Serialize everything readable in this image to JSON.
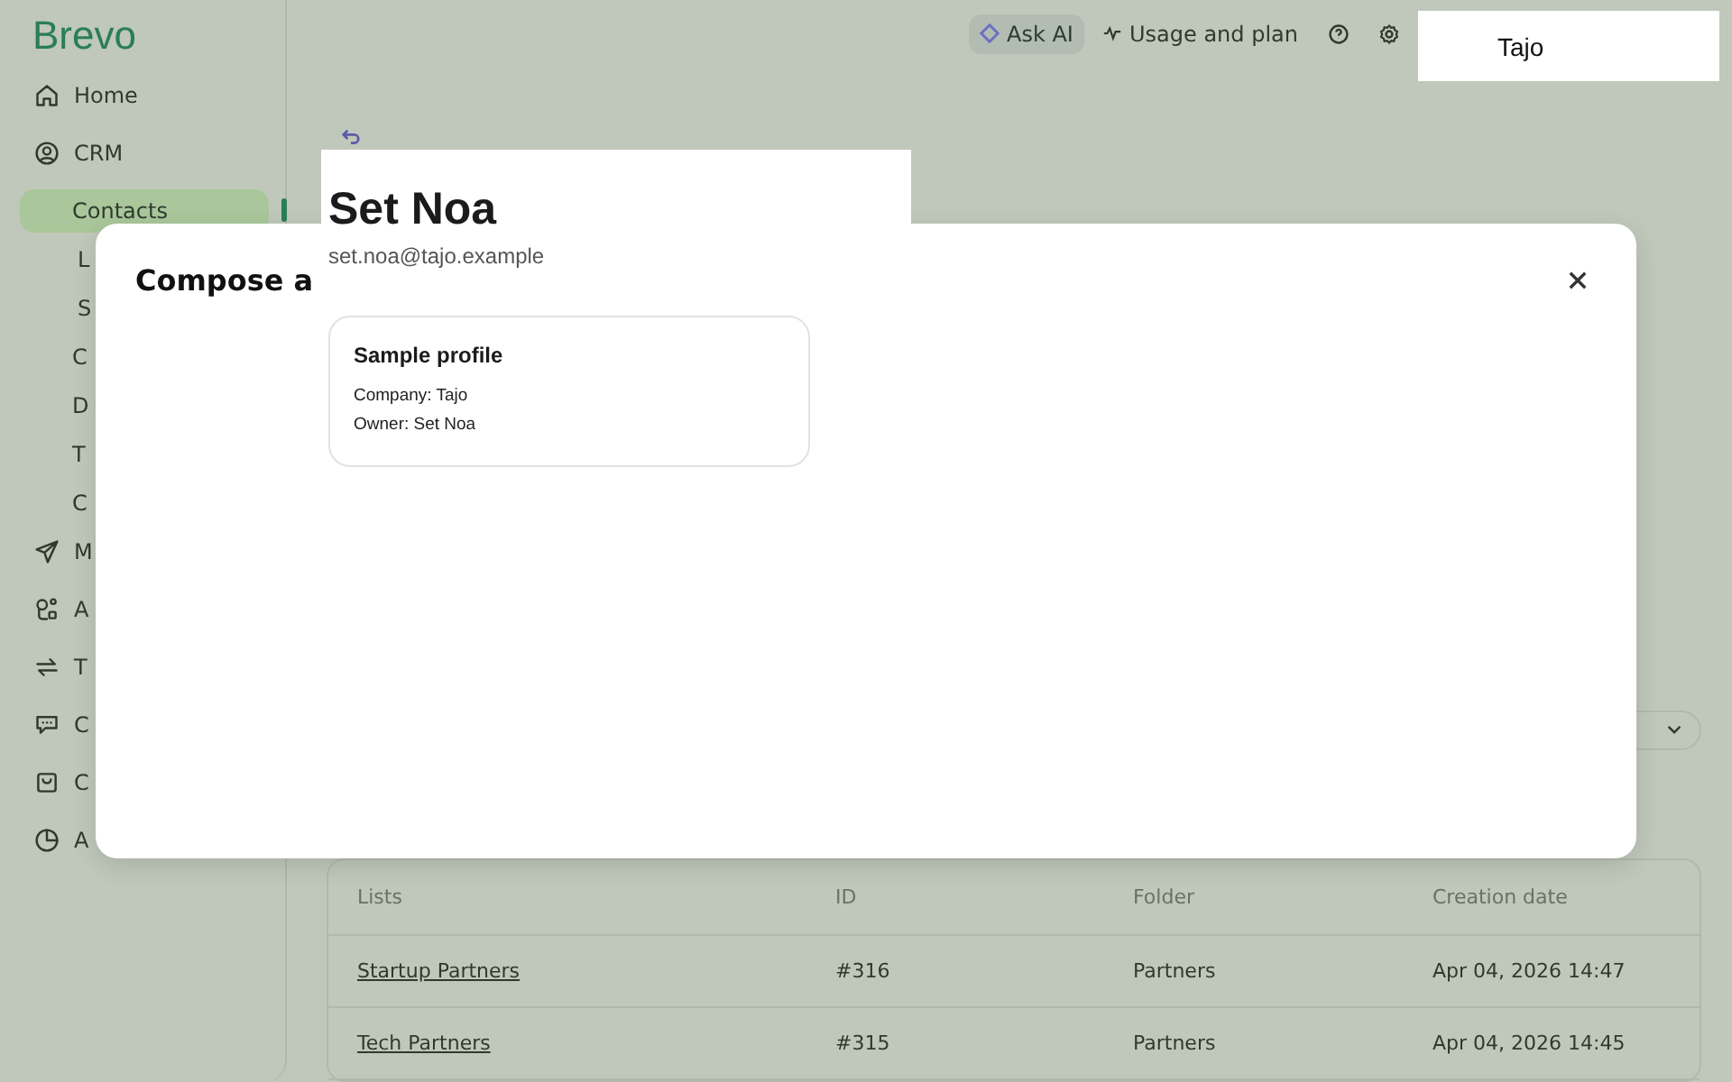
{
  "logo": "Brevo",
  "sidebar": {
    "items": [
      {
        "label": "Home",
        "selected": false
      },
      {
        "label": "CRM",
        "selected": false,
        "children": [
          {
            "label": "Contacts",
            "selected": true,
            "children": [
              {
                "label": "L",
                "selected": false
              },
              {
                "label": "S",
                "selected": false
              }
            ]
          },
          {
            "label": "C",
            "selected": false
          },
          {
            "label": "D",
            "selected": false
          },
          {
            "label": "T",
            "selected": false
          },
          {
            "label": "C",
            "selected": false
          }
        ]
      },
      {
        "label": "M",
        "selected": false
      },
      {
        "label": "A",
        "selected": false
      },
      {
        "label": "T",
        "selected": false
      },
      {
        "label": "C",
        "selected": false
      },
      {
        "label": "C",
        "selected": false
      },
      {
        "label": "A",
        "selected": false
      }
    ]
  },
  "top_bar": {
    "ask_ai": "Ask AI",
    "usage": "Usage and plan",
    "account": "Tajo"
  },
  "table": {
    "columns": [
      "Lists",
      "ID",
      "Folder",
      "Creation date"
    ],
    "rows": [
      [
        "Startup Partners",
        "#316",
        "Partners",
        "Apr 04, 2026 14:47"
      ],
      [
        "Tech Partners",
        "#315",
        "Partners",
        "Apr 04, 2026 14:45"
      ]
    ]
  },
  "modal": {
    "title": "Compose a"
  },
  "profile": {
    "name": "Set Noa",
    "email": "set.noa@tajo.example",
    "card_title": "Sample profile",
    "lines": [
      "Company: Tajo",
      "Owner: Set Noa"
    ]
  }
}
